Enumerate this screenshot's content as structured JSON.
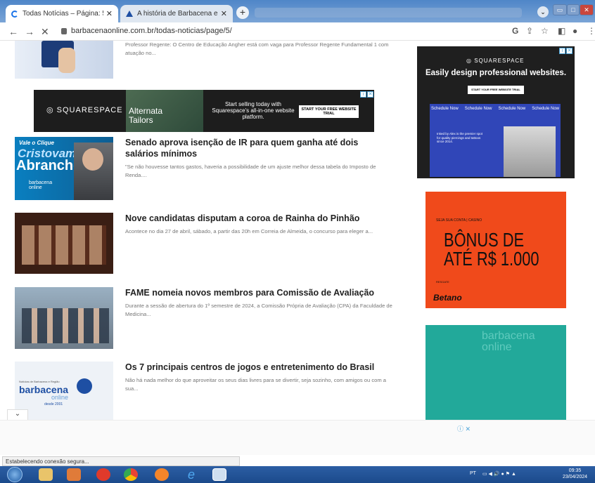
{
  "browser": {
    "tabs": [
      {
        "label": "Todas Notícias – Página: 5 – Barb",
        "active": true
      },
      {
        "label": "A história de Barbacena em fotos",
        "active": false
      }
    ],
    "url": "barbacenaonline.com.br/todas-noticias/page/5/"
  },
  "articles": [
    {
      "title": "",
      "excerpt": "Professor Regente: O Centro de Educação Angher está com vaga para Professor Regente Fundamental 1 com atuação no..."
    },
    {
      "title": "Senado aprova isenção de IR para quem ganha até dois salários mínimos",
      "excerpt": "\"Se não houvesse tantos gastos, haveria a possibilidade de um ajuste melhor dessa tabela do Imposto de Renda....",
      "thumb_text": {
        "line1": "Vale o Clique",
        "line2": "Cristovam",
        "line3": "Abranches",
        "brand": "barbacena online"
      }
    },
    {
      "title": "Nove candidatas disputam a coroa de Rainha do Pinhão",
      "excerpt": "Acontece no dia 27 de abril, sábado, a partir das 20h em Correia de Almeida, o concurso para eleger a..."
    },
    {
      "title": "FAME nomeia novos membros para Comissão de Avaliação",
      "excerpt": "Durante a sessão de abertura do 1º semestre de 2024, a Comissão Própria de Avaliação (CPA) da Faculdade de Medicina..."
    },
    {
      "title": "Os 7 principais centros de jogos e entretenimento do Brasil",
      "excerpt": "Não há nada melhor do que aproveitar os seus dias livres para se divertir, seja sozinho, com amigos ou com a sua...",
      "thumb_text": {
        "small": "Notícias de Barbacena e Região",
        "brand": "barbacena",
        "sub": "online",
        "since": "desde 2001"
      }
    }
  ],
  "ads": {
    "squarespace_banner": {
      "logo": "SQUARESPACE",
      "photo_text": "Alternata Tailors",
      "headline": "Start selling today with Squarespace's all-in-one website platform.",
      "button": "START YOUR FREE WEBSITE TRIAL"
    },
    "squarespace_side": {
      "logo": "SQUARESPACE",
      "headline": "Easily design professional websites.",
      "button": "START YOUR FREE WEBSITE TRIAL",
      "nav": [
        "Schedule Now",
        "Schedule Now",
        "Schedule Now",
        "Schedule Now"
      ],
      "copy": "Inked by Alex is the premier spot for quality piercings and tattoos since 2014."
    },
    "betano": {
      "small": "SEJA SUA CONTA  |  CASINO",
      "headline": "BÔNUS DE ATÉ R$ 1.000",
      "mini": "RESGATE",
      "logo": "Betano"
    },
    "teal": {
      "text": "barbacena online"
    }
  },
  "status_text": "Estabelecendo conexão segura...",
  "taskbar": {
    "lang": "PT",
    "time": "09:35",
    "date": "23/04/2024"
  },
  "colors": {
    "betano": "#f04a1b",
    "squarespace_blue": "#3046b8",
    "teal": "#22a99a"
  }
}
